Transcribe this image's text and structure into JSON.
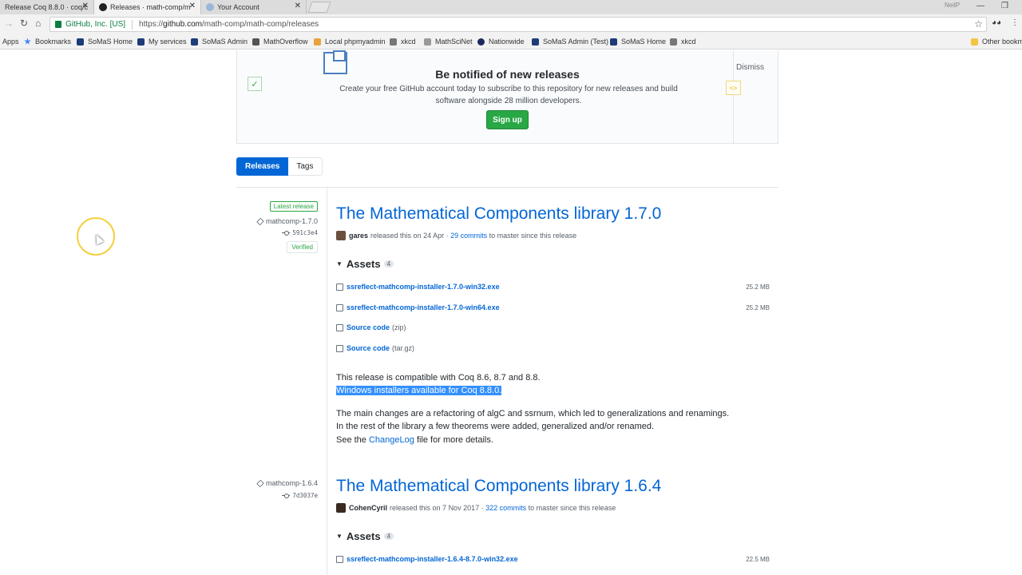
{
  "browser": {
    "tabs": [
      {
        "title": "Release Coq 8.8.0 · coq/c"
      },
      {
        "title": "Releases · math-comp/m"
      },
      {
        "title": "Your Account"
      }
    ],
    "profile_name": "NeilP",
    "site_identity": "GitHub, Inc. [US]",
    "url_prefix": "https://",
    "url_host": "github.com",
    "url_path": "/math-comp/math-comp/releases",
    "bookmarks": [
      "Apps",
      "Bookmarks",
      "SoMaS Home",
      "My services",
      "SoMaS Admin",
      "MathOverflow",
      "Local phpmyadmin",
      "xkcd",
      "MathSciNet",
      "Nationwide",
      "SoMaS Admin (Test)",
      "SoMaS Home",
      "xkcd"
    ],
    "other_bookmarks": "Other bookm"
  },
  "signup": {
    "title": "Be notified of new releases",
    "text": "Create your free GitHub account today to subscribe to this repository for new releases and build software alongside 28 million developers.",
    "button": "Sign up",
    "dismiss": "Dismiss"
  },
  "subnav": {
    "releases": "Releases",
    "tags": "Tags"
  },
  "releases": [
    {
      "badge": "Latest release",
      "tag": "mathcomp-1.7.0",
      "commit": "591c3e4",
      "verified": "Verified",
      "title": "The Mathematical Components library 1.7.0",
      "author": "gares",
      "released_text": "released this on 24 Apr ·",
      "commits_link": "29 commits",
      "commits_suffix": "to master since this release",
      "assets_label": "Assets",
      "assets_count": "4",
      "assets": [
        {
          "name": "ssreflect-mathcomp-installer-1.7.0-win32.exe",
          "kind": "",
          "size": "25.2 MB"
        },
        {
          "name": "ssreflect-mathcomp-installer-1.7.0-win64.exe",
          "kind": "",
          "size": "25.2 MB"
        },
        {
          "name": "Source code",
          "kind": "(zip)",
          "size": ""
        },
        {
          "name": "Source code",
          "kind": "(tar.gz)",
          "size": ""
        }
      ],
      "note1": "This release is compatible with Coq 8.6, 8.7 and 8.8.",
      "note2": "Windows installers available for Coq 8.8.0.",
      "para1": "The main changes are a refactoring of algC and ssrnum, which led to generalizations and renamings.",
      "para2": "In the rest of the library a few theorems were added, generalized and/or renamed.",
      "para3_pre": "See the",
      "para3_link": "ChangeLog",
      "para3_post": "file for more details."
    },
    {
      "tag": "mathcomp-1.6.4",
      "commit": "7d3037e",
      "title": "The Mathematical Components library 1.6.4",
      "author": "CohenCyril",
      "released_text": "released this on 7 Nov 2017 ·",
      "commits_link": "322 commits",
      "commits_suffix": "to master since this release",
      "assets_label": "Assets",
      "assets_count": "4",
      "assets": [
        {
          "name": "ssreflect-mathcomp-installer-1.6.4-8.7.0-win32.exe",
          "kind": "",
          "size": "22.5 MB"
        }
      ]
    }
  ]
}
